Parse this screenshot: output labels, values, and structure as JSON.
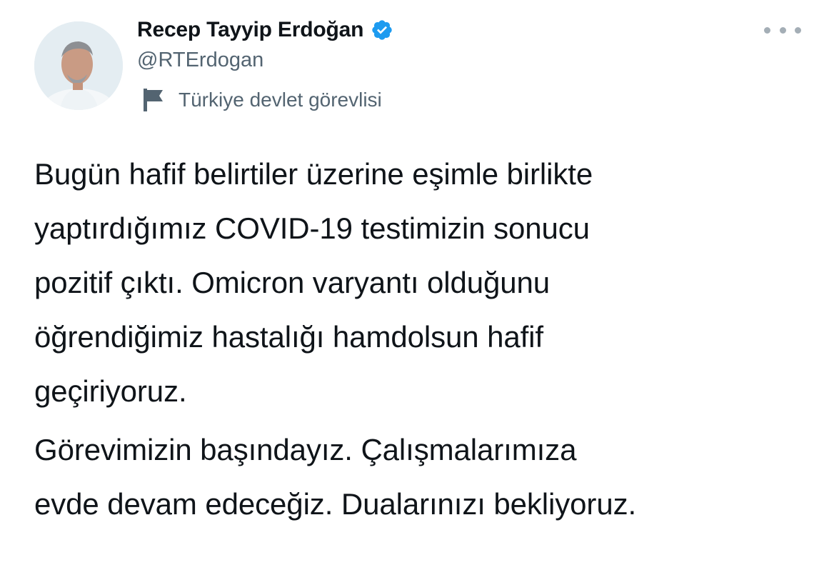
{
  "author": {
    "display_name": "Recep Tayyip Erdoğan",
    "handle": "@RTErdogan",
    "account_label": "Türkiye devlet görevlisi",
    "verified": true
  },
  "tweet": {
    "paragraph1": [
      "Bugün hafif belirtiler üzerine eşimle birlikte",
      "yaptırdığımız COVID-19 testimizin sonucu",
      "pozitif çıktı. Omicron varyantı olduğunu",
      "öğrendiğimiz hastalığı hamdolsun hafif",
      "geçiriyoruz."
    ],
    "paragraph2": [
      "Görevimizin başındayız. Çalışmalarımıza",
      "evde devam edeceğiz. Dualarınızı bekliyoruz."
    ]
  },
  "icons": {
    "verified": "verified-badge-icon",
    "label": "flag-icon",
    "more": "more-options-icon"
  },
  "colors": {
    "verified_blue": "#1d9bf0",
    "text_primary": "#0f1419",
    "text_secondary": "#536471"
  }
}
